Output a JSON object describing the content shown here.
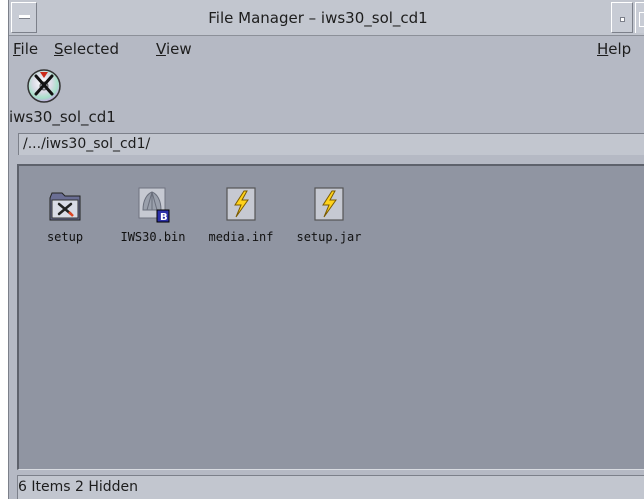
{
  "window": {
    "title": "File Manager – iws30_sol_cd1"
  },
  "menubar": {
    "items": [
      {
        "label_mnemonic": "F",
        "label_rest": "ile"
      },
      {
        "label_mnemonic": "S",
        "label_rest": "elected"
      },
      {
        "label_mnemonic": "V",
        "label_rest": "iew"
      }
    ],
    "help": {
      "label_mnemonic": "H",
      "label_rest": "elp"
    }
  },
  "volume": {
    "icon": "cdrom-icon",
    "label": "iws30_sol_cd1"
  },
  "path": {
    "value": "/.../iws30_sol_cd1/"
  },
  "files": [
    {
      "name": "setup",
      "icon": "folder-icon"
    },
    {
      "name": "IWS30.bin",
      "icon": "binary-file-icon"
    },
    {
      "name": "media.inf",
      "icon": "data-file-icon"
    },
    {
      "name": "setup.jar",
      "icon": "data-file-icon"
    }
  ],
  "status": {
    "text": "6 Items 2 Hidden"
  },
  "colors": {
    "window_bg": "#b5b9c4",
    "file_area_bg": "#9095a2",
    "lightning": "#ffd21a"
  }
}
